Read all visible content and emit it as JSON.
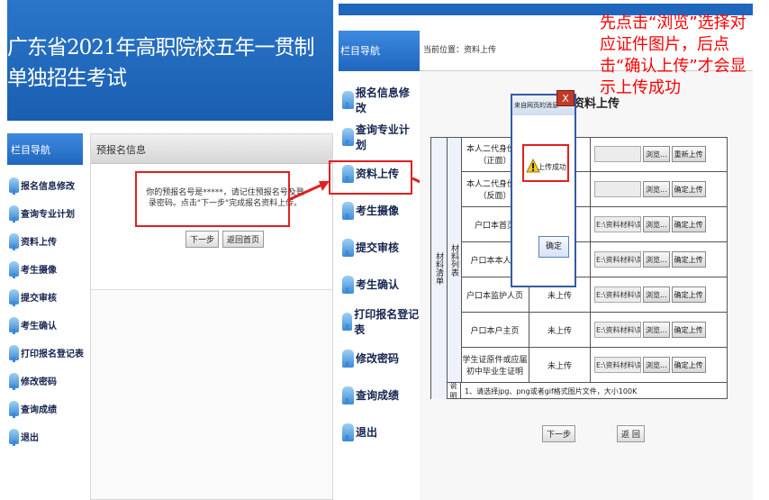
{
  "left": {
    "banner_title": "广东省2021年高职院校五年一贯制单独招生考试",
    "nav_header": "栏目导航",
    "nav_items": [
      "报名信息修改",
      "查询专业计划",
      "资料上传",
      "考生摄像",
      "提交审核",
      "考生确认",
      "打印报名登记表",
      "修改密码",
      "查询成绩",
      "退出"
    ],
    "panel_title": "预报名信息",
    "message": "你的预报名号是*****，请记住预报名号及登录密码。点击\"下一步\"完成报名资料上传。",
    "btn_next": "下一步",
    "btn_home": "返回首页"
  },
  "right": {
    "nav_header": "栏目导航",
    "nav_items": [
      "报名信息修改",
      "查询专业计划",
      "资料上传",
      "考生摄像",
      "提交审核",
      "考生确认",
      "打印报名登记表",
      "修改密码",
      "查询成绩",
      "退出"
    ],
    "breadcrumb": "当前位置：资料上传",
    "section_title": "资料上传",
    "group_label_1": "材料列表",
    "group_label_2": "材料清单",
    "rows": [
      {
        "name": "本人二代身份证（正面）",
        "status": "",
        "file": "",
        "browse": "浏览...",
        "action": "重新上传"
      },
      {
        "name": "本人二代身份证（反面）",
        "status": "",
        "file": "",
        "browse": "浏览...",
        "action": "确定上传"
      },
      {
        "name": "户口本首页",
        "status": "",
        "file": "E:\\资料材料\\简章 2021",
        "browse": "浏览...",
        "action": "确定上传"
      },
      {
        "name": "户口本本人页",
        "status": "",
        "file": "E:\\资料材料\\简章 2021",
        "browse": "浏览...",
        "action": "确定上传"
      },
      {
        "name": "户口本监护人页",
        "status": "未上传",
        "file": "E:\\资料材料\\简章 2021",
        "browse": "浏览...",
        "action": "确定上传"
      },
      {
        "name": "户口本户主页",
        "status": "未上传",
        "file": "E:\\资料材料\\简章 2021",
        "browse": "浏览...",
        "action": "确定上传"
      },
      {
        "name": "学生证原件或应届初中毕业生证明",
        "status": "未上传",
        "file": "E:\\资料材料\\简章 2021",
        "browse": "浏览...",
        "action": "确定上传"
      }
    ],
    "note_label": "说明",
    "note_text": "1、请选择jpg、png或者gif格式图片文件，大小100K",
    "btn_next": "下一步",
    "btn_back": "返 回",
    "dialog_title": "来自网页的消息",
    "dialog_close": "X",
    "dialog_message": "上传成功！",
    "dialog_ok": "确定"
  },
  "annotation": "先点击“浏览”选择对应证件图片，后点击“确认上传”才会显示上传成功",
  "colors": {
    "accent": "#1f66bd",
    "annotation_red": "#ff0000"
  }
}
